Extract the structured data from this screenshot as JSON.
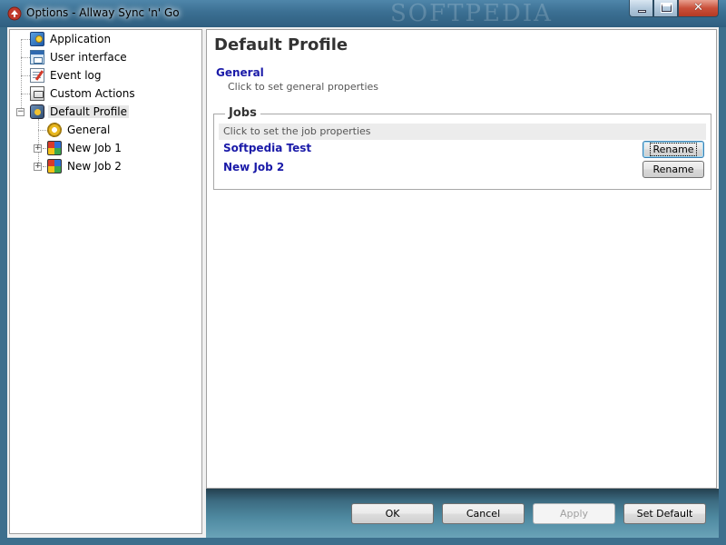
{
  "window": {
    "title": "Options - Allway Sync 'n' Go",
    "watermark": "SOFTPEDIA",
    "minimize_label": "",
    "maximize_label": "",
    "close_label": "✕"
  },
  "tree": {
    "items": [
      {
        "label": "Application",
        "icon": "application-icon"
      },
      {
        "label": "User interface",
        "icon": "user-interface-icon"
      },
      {
        "label": "Event log",
        "icon": "event-log-icon"
      },
      {
        "label": "Custom Actions",
        "icon": "custom-actions-icon"
      },
      {
        "label": "Default Profile",
        "icon": "profile-icon",
        "selected": true,
        "expanded": true
      },
      {
        "label": "General",
        "icon": "gear-icon"
      },
      {
        "label": "New Job 1",
        "icon": "job-icon",
        "expander": "+"
      },
      {
        "label": "New Job 2",
        "icon": "job-icon",
        "expander": "+"
      }
    ],
    "collapse_glyph": "−"
  },
  "content": {
    "title": "Default Profile",
    "general_link": "General",
    "general_desc": "Click to set general properties",
    "jobs_legend": "Jobs",
    "jobs_desc": "Click to set the job properties",
    "jobs": [
      {
        "name": "Softpedia Test",
        "rename_label": "Rename"
      },
      {
        "name": "New Job 2",
        "rename_label": "Rename"
      }
    ]
  },
  "footer": {
    "ok": "OK",
    "cancel": "Cancel",
    "apply": "Apply",
    "set_default": "Set Default"
  },
  "colors": {
    "link": "#1a1aa8",
    "titlebar": "#3b6f92",
    "footer": "#3c6b81"
  }
}
